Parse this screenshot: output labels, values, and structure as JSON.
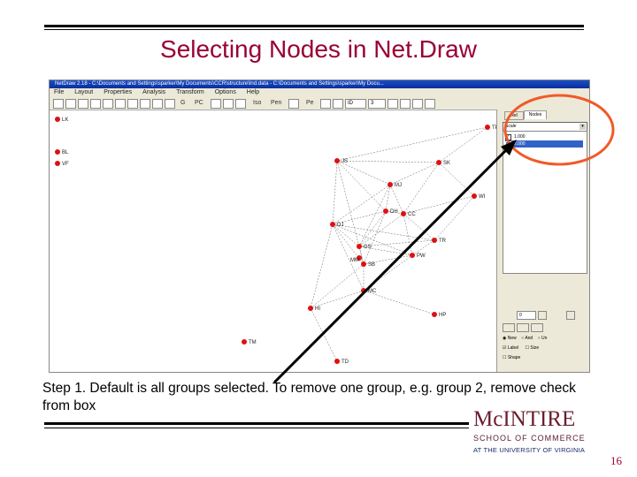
{
  "slide": {
    "title": "Selecting Nodes in Net.Draw",
    "caption": "Step 1. Default is all groups selected.  To remove one group, e.g. group 2, remove check from box",
    "page_number": "16",
    "colors": {
      "title": "#990033",
      "node": "#dd1111",
      "highlight_circle": "#f05a28",
      "arrow": "#000000"
    }
  },
  "logo": {
    "name": "McINTIRE",
    "line2": "SCHOOL OF COMMERCE",
    "line3": "AT THE UNIVERSITY OF VIRGINIA"
  },
  "netdraw": {
    "window_title": "NetDraw 2.18 - C:\\Documents and Settings\\sparker\\My Documents\\CCR\\structure\\Ind.data - C:\\Documents and Settings\\sparker\\My Docu...",
    "menu": [
      "File",
      "Layout",
      "Properties",
      "Analysis",
      "Transform",
      "Options",
      "Help"
    ],
    "toolbar": {
      "items": [
        "G",
        "PC",
        "Iso",
        "Pen",
        "Pe",
        "ID"
      ],
      "dropdown_value": "ID",
      "spin_value": "3"
    },
    "side_panel": {
      "tabs": [
        "Rel",
        "Nodes"
      ],
      "attribute_select": "Scale",
      "groups": [
        {
          "label": "1.000",
          "checked": true
        },
        {
          "label": "2.000",
          "checked": true
        }
      ],
      "lower": {
        "spin_value": "0",
        "radio": [
          "New",
          "And",
          "Un"
        ],
        "checks": [
          "Label",
          "Size",
          "Shape"
        ]
      }
    },
    "nodes": [
      {
        "id": "LK"
      },
      {
        "id": "BL"
      },
      {
        "id": "VF"
      },
      {
        "id": "JS"
      },
      {
        "id": "SK"
      },
      {
        "id": "MJ"
      },
      {
        "id": "WI"
      },
      {
        "id": "DH"
      },
      {
        "id": "CC"
      },
      {
        "id": "DJ"
      },
      {
        "id": "TR"
      },
      {
        "id": "GS"
      },
      {
        "id": "SB"
      },
      {
        "id": "PW"
      },
      {
        "id": "MM"
      },
      {
        "id": "MC"
      },
      {
        "id": "HI"
      },
      {
        "id": "HP"
      },
      {
        "id": "TM"
      },
      {
        "id": "TD"
      },
      {
        "id": "TP"
      }
    ]
  }
}
